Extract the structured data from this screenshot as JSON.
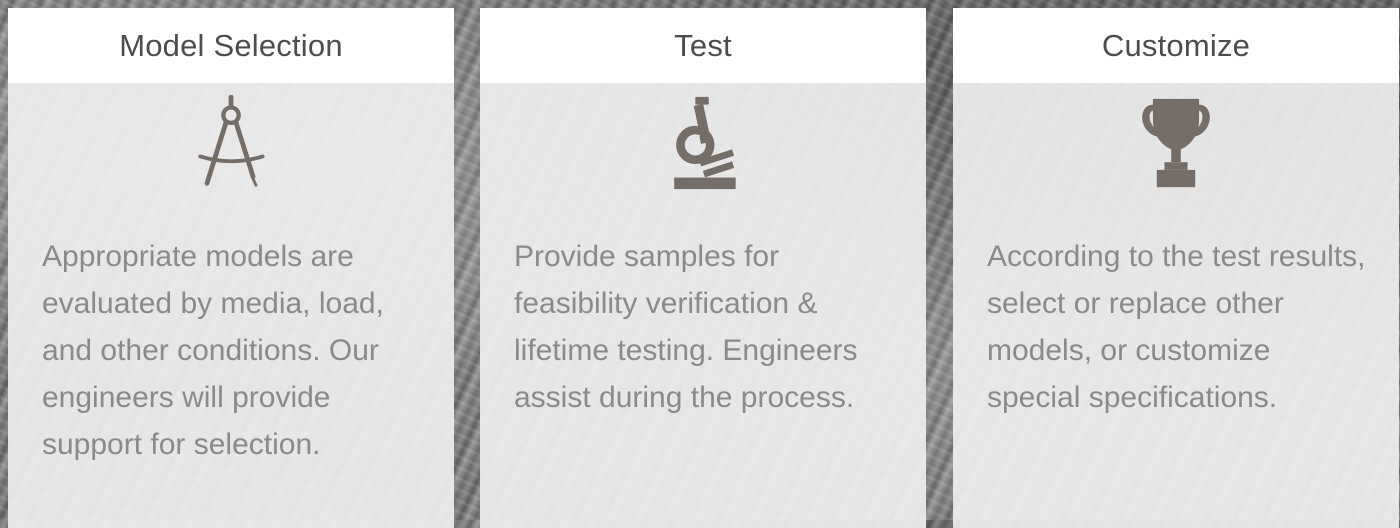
{
  "cards": [
    {
      "title": "Model Selection",
      "icon": "compass-icon",
      "description": "Appropriate models are evaluated by media, load, and other conditions. Our engineers will provide support for selection."
    },
    {
      "title": "Test",
      "icon": "microscope-icon",
      "description": "Provide samples for feasibility verification & lifetime testing. Engineers assist during the process."
    },
    {
      "title": "Customize",
      "icon": "trophy-icon",
      "description": "According to the test results, select or replace other models, or customize special specifications."
    }
  ],
  "colors": {
    "icon": "#756d68",
    "title_text": "#4d4d4d",
    "body_text": "#8a8a8a",
    "header_bg": "#ffffff",
    "card_bg": "#eeeeee"
  }
}
